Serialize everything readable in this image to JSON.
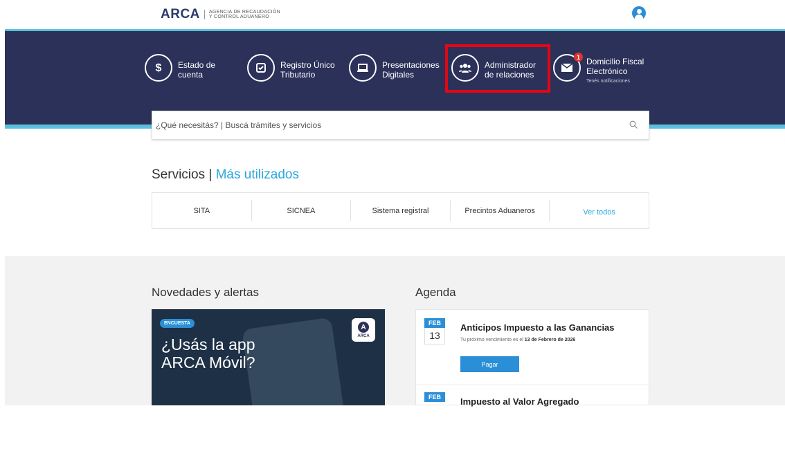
{
  "header": {
    "logo_text": "ARCA",
    "logo_subtitle_line1": "AGENCIA DE RECAUDACIÓN",
    "logo_subtitle_line2": "Y CONTROL ADUANERO"
  },
  "quick_access": [
    {
      "label_line1": "Estado de",
      "label_line2": "cuenta",
      "icon": "dollar-icon"
    },
    {
      "label_line1": "Registro Único",
      "label_line2": "Tributario",
      "icon": "check-document-icon"
    },
    {
      "label_line1": "Presentaciones",
      "label_line2": "Digitales",
      "icon": "laptop-icon"
    },
    {
      "label_line1": "Administrador",
      "label_line2": "de relaciones",
      "icon": "users-icon"
    },
    {
      "label_line1": "Domicilio Fiscal",
      "label_line2": "Electrónico",
      "sub": "Tenés notificaciones",
      "badge": "1",
      "icon": "envelope-icon"
    }
  ],
  "search": {
    "placeholder": "¿Qué necesitás? | Buscá trámites y servicios"
  },
  "services": {
    "title_prefix": "Servicios |",
    "title_highlight": "Más utilizados",
    "items": [
      "SITA",
      "SICNEA",
      "Sistema registral",
      "Precintos Aduaneros"
    ],
    "see_all": "Ver todos"
  },
  "news": {
    "title": "Novedades y alertas",
    "card_tag": "ENCUESTA",
    "card_question_line1": "¿Usás la app",
    "card_question_line2": "ARCA Móvil?",
    "card_app_letter": "A",
    "card_app_text": "ARCA"
  },
  "agenda": {
    "title": "Agenda",
    "events": [
      {
        "month": "FEB",
        "day": "13",
        "title": "Anticipos Impuesto a las Ganancias",
        "subtitle_prefix": "Tu próximo vencimiento es el",
        "subtitle_date": "13 de Febrero de 2026",
        "button": "Pagar"
      },
      {
        "month": "FEB",
        "day": "",
        "title": "Impuesto al Valor Agregado"
      }
    ]
  },
  "colors": {
    "navy": "#2b3159",
    "accent": "#5bc0de",
    "link": "#2aa7de",
    "highlight": "#e30613"
  }
}
